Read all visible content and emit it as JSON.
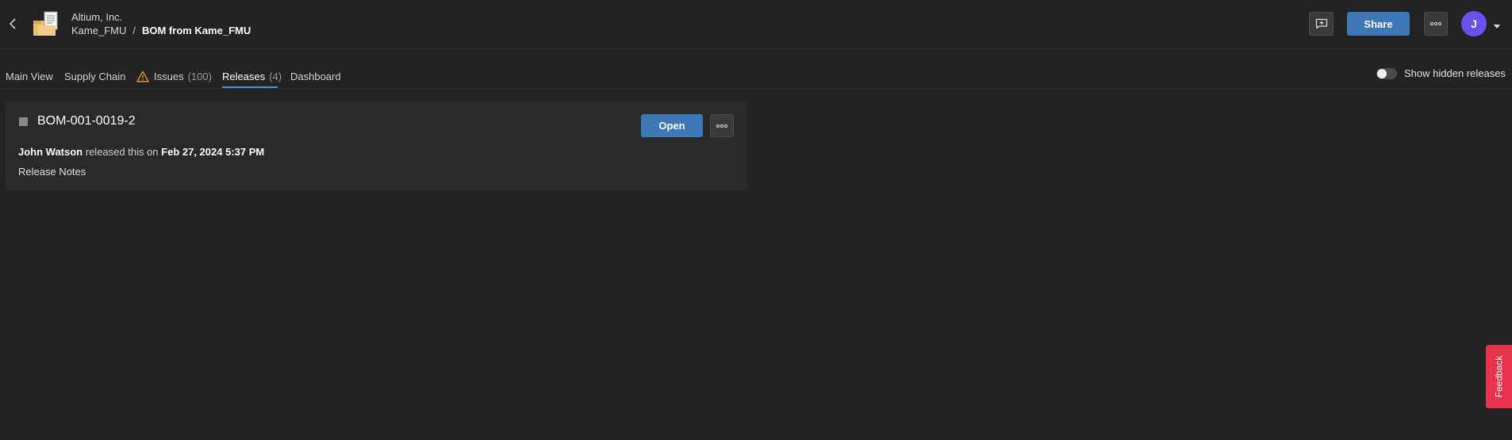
{
  "header": {
    "org_name": "Altium, Inc.",
    "breadcrumb": {
      "project": "Kame_FMU",
      "separator": "/",
      "current": "BOM from Kame_FMU"
    },
    "share_label": "Share",
    "avatar_initial": "J"
  },
  "tabs": [
    {
      "label": "Main View"
    },
    {
      "label": "Supply Chain"
    },
    {
      "label": "Issues",
      "count": "(100)"
    },
    {
      "label": "Releases",
      "count": "(4)",
      "active": true
    },
    {
      "label": "Dashboard"
    }
  ],
  "toggle": {
    "label": "Show hidden releases",
    "enabled": false
  },
  "release": {
    "title": "BOM-001-0019-2",
    "open_label": "Open",
    "author": "John Watson",
    "action_text": "released this on",
    "date": "Feb 27, 2024 5:37 PM",
    "notes_label": "Release Notes"
  },
  "feedback_label": "Feedback",
  "colors": {
    "background": "#232323",
    "card": "#2a2a2a",
    "accent_blue": "#3d79b8",
    "avatar": "#6b4ff0",
    "feedback": "#e8324a",
    "warning": "#e8a13a",
    "active_tab_underline": "#4a8fd8"
  },
  "icons": {
    "back": "chevron-left-icon",
    "project": "project-folder-icon",
    "comment": "comment-add-icon",
    "more": "more-horizontal-icon",
    "warning": "warning-triangle-icon",
    "caret": "caret-down-icon"
  }
}
